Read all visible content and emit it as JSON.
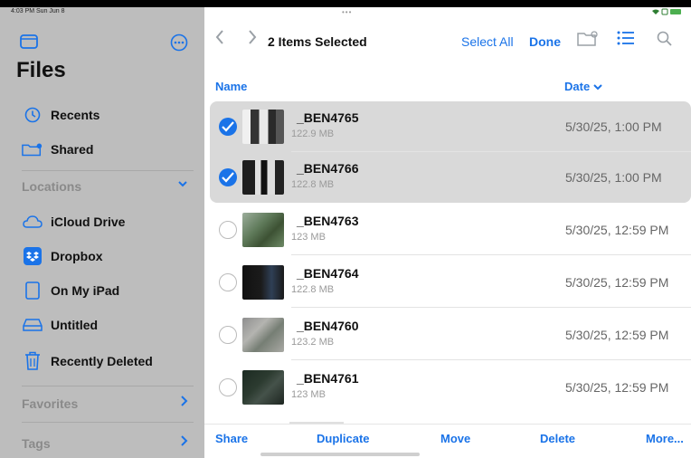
{
  "status": {
    "time_date": "4:03 PM  Sun Jun 8",
    "top_dots": "•••"
  },
  "sidebar": {
    "title": "Files",
    "favorites_nav": [
      {
        "label": "Recents",
        "icon": "clock-icon"
      },
      {
        "label": "Shared",
        "icon": "shared-folder-icon"
      }
    ],
    "locations_label": "Locations",
    "locations": [
      {
        "label": "iCloud Drive",
        "icon": "cloud-icon"
      },
      {
        "label": "Dropbox",
        "icon": "dropbox-icon"
      },
      {
        "label": "On My iPad",
        "icon": "ipad-icon"
      },
      {
        "label": "Untitled",
        "icon": "drive-icon"
      },
      {
        "label": "Recently Deleted",
        "icon": "trash-icon"
      }
    ],
    "favorites_label": "Favorites",
    "tags_label": "Tags"
  },
  "header": {
    "title": "2 Items Selected",
    "select_all": "Select All",
    "done": "Done"
  },
  "columns": {
    "name": "Name",
    "date": "Date"
  },
  "files": [
    {
      "name": "_BEN4765",
      "size": "122.9 MB",
      "date": "5/30/25, 1:00 PM",
      "selected": true
    },
    {
      "name": "_BEN4766",
      "size": "122.8 MB",
      "date": "5/30/25, 1:00 PM",
      "selected": true
    },
    {
      "name": "_BEN4763",
      "size": "123 MB",
      "date": "5/30/25, 12:59 PM",
      "selected": false
    },
    {
      "name": "_BEN4764",
      "size": "122.8 MB",
      "date": "5/30/25, 12:59 PM",
      "selected": false
    },
    {
      "name": "_BEN4760",
      "size": "123.2 MB",
      "date": "5/30/25, 12:59 PM",
      "selected": false
    },
    {
      "name": "_BEN4761",
      "size": "123 MB",
      "date": "5/30/25, 12:59 PM",
      "selected": false
    }
  ],
  "toolbar": {
    "share": "Share",
    "duplicate": "Duplicate",
    "move": "Move",
    "delete": "Delete",
    "more": "More..."
  },
  "colors": {
    "accent": "#1a73e8",
    "sidebar_bg": "#bdbdbd",
    "selected_row": "#d9d9d9"
  }
}
